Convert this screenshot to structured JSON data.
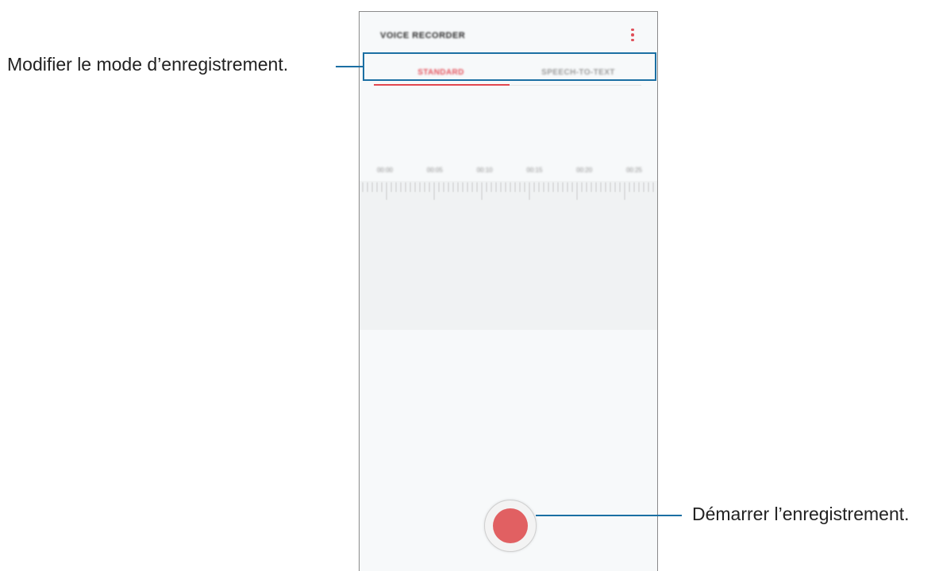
{
  "app": {
    "title": "VOICE RECORDER"
  },
  "tabs": [
    {
      "label": "STANDARD",
      "selected": true
    },
    {
      "label": "SPEECH-TO-TEXT",
      "selected": false
    }
  ],
  "timeline": {
    "labels": [
      "00:00",
      "00:05",
      "00:10",
      "00:15",
      "00:20",
      "00:25"
    ]
  },
  "callouts": {
    "mode": "Modifier le mode d’enregistrement.",
    "record": "Démarrer l’enregistrement."
  },
  "colors": {
    "accent": "#e2474f",
    "record_button": "#e16062",
    "callout": "#1b6fa3"
  },
  "icons": {
    "more": "more-vertical-icon",
    "record": "record-icon"
  }
}
